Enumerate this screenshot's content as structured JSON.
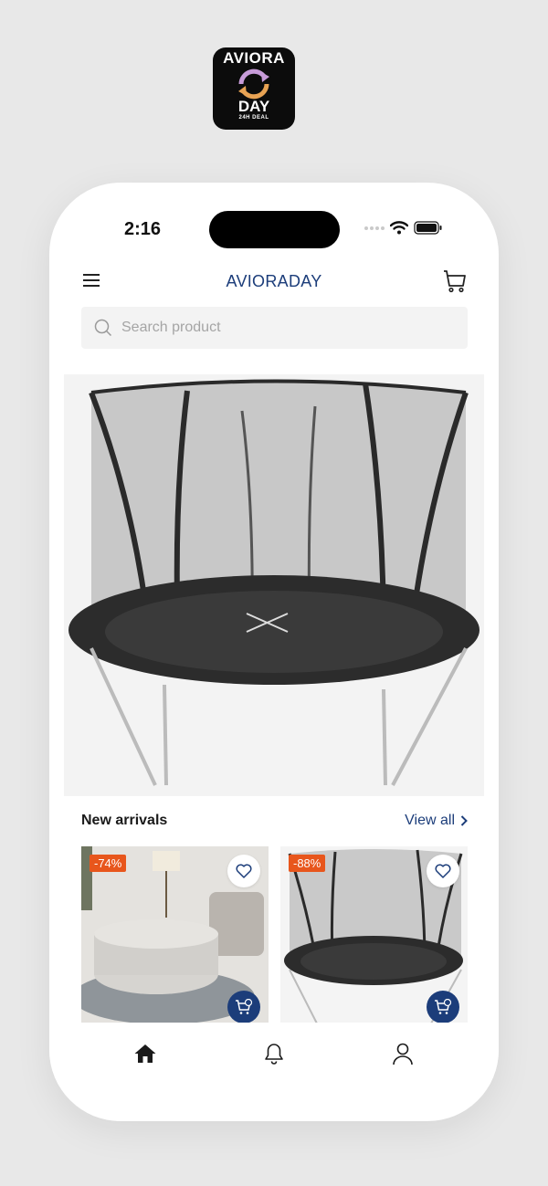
{
  "logo": {
    "line1": "AVIORA",
    "line2": "DAY",
    "line3": "24H DEAL"
  },
  "status": {
    "time": "2:16"
  },
  "header": {
    "brand": "AVIORADAY"
  },
  "search": {
    "placeholder": "Search product"
  },
  "section": {
    "title": "New arrivals",
    "view_all": "View all"
  },
  "products": [
    {
      "discount": "-74%"
    },
    {
      "discount": "-88%"
    }
  ],
  "colors": {
    "brand": "#1c3d7a",
    "badge": "#e8561c",
    "background": "#e8e8e8"
  },
  "tabs": [
    {
      "icon": "home-icon"
    },
    {
      "icon": "bell-icon"
    },
    {
      "icon": "user-icon"
    }
  ]
}
